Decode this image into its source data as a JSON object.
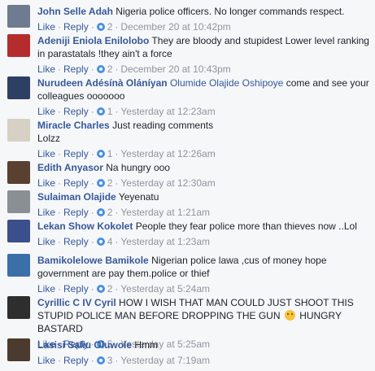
{
  "comments": [
    {
      "author": "John Selle Adah",
      "mention": "",
      "text": "Nigeria police officers. No longer commands respect.",
      "like": "Like",
      "reply": "Reply",
      "replies": "2",
      "time": "December 20 at 10:42pm",
      "avatar_color": "#6f7b8e"
    },
    {
      "author": "Adeniji Eniola Enilolobo",
      "mention": "",
      "text": "They are bloody and stupidest Lower level ranking in parastatals !they ain't a force",
      "like": "Like",
      "reply": "Reply",
      "replies": "2",
      "time": "December 20 at 10:43pm",
      "avatar_color": "#b52c2c"
    },
    {
      "author": "Nurudeen Adésínà Oláníyan",
      "mention": "Olumide Olajide Oshipoye",
      "text": "come and see your colleagues ooooooo",
      "like": "Like",
      "reply": "Reply",
      "replies": "1",
      "time": "Yesterday at 12:23am",
      "avatar_color": "#2d3f63"
    },
    {
      "author": "Miracle Charles",
      "mention": "",
      "text": "Just reading comments\nLolzz",
      "like": "Like",
      "reply": "Reply",
      "replies": "1",
      "time": "Yesterday at 12:26am",
      "avatar_color": "#d6d1c4"
    },
    {
      "author": "Edith Anyasor",
      "mention": "",
      "text": "Na hungry ooo",
      "like": "Like",
      "reply": "Reply",
      "replies": "2",
      "time": "Yesterday at 12:30am",
      "avatar_color": "#5a4030"
    },
    {
      "author": "Sulaiman Olajide",
      "mention": "",
      "text": "Yeyenatu",
      "like": "Like",
      "reply": "Reply",
      "replies": "2",
      "time": "Yesterday at 1:21am",
      "avatar_color": "#8a8f94"
    },
    {
      "author": "Lekan Show Kokolet",
      "mention": "",
      "text": "People they fear police more than thieves now ..Lol",
      "like": "Like",
      "reply": "Reply",
      "replies": "4",
      "time": "Yesterday at 1:23am",
      "avatar_color": "#3a4f8c"
    },
    {
      "author": "Bamikolelowe Bamikole",
      "mention": "",
      "text": "Nigerian police lawa ,cus of money hope government are pay them.police or thief",
      "like": "Like",
      "reply": "Reply",
      "replies": "2",
      "time": "Yesterday at 5:24am",
      "avatar_color": "#3b6fa8"
    },
    {
      "author": "Cyrillic C IV Cyril",
      "mention": "",
      "text": "HOW I WISH THAT MAN COULD JUST SHOOT THIS STUPID POLICE MAN BEFORE DROPPING THE GUN",
      "text_after": "HUNGRY BASTARD",
      "emoji": "pensive-face",
      "like": "Like",
      "reply": "Reply",
      "replies": "5",
      "time": "Yesterday at 5:25am",
      "avatar_color": "#2e2e2e"
    },
    {
      "author": "Lasisi Saliu Oluwole",
      "mention": "",
      "text": "Hmm",
      "like": "Like",
      "reply": "Reply",
      "replies": "3",
      "time": "Yesterday at 7:19am",
      "avatar_color": "#4a3b2e"
    }
  ]
}
